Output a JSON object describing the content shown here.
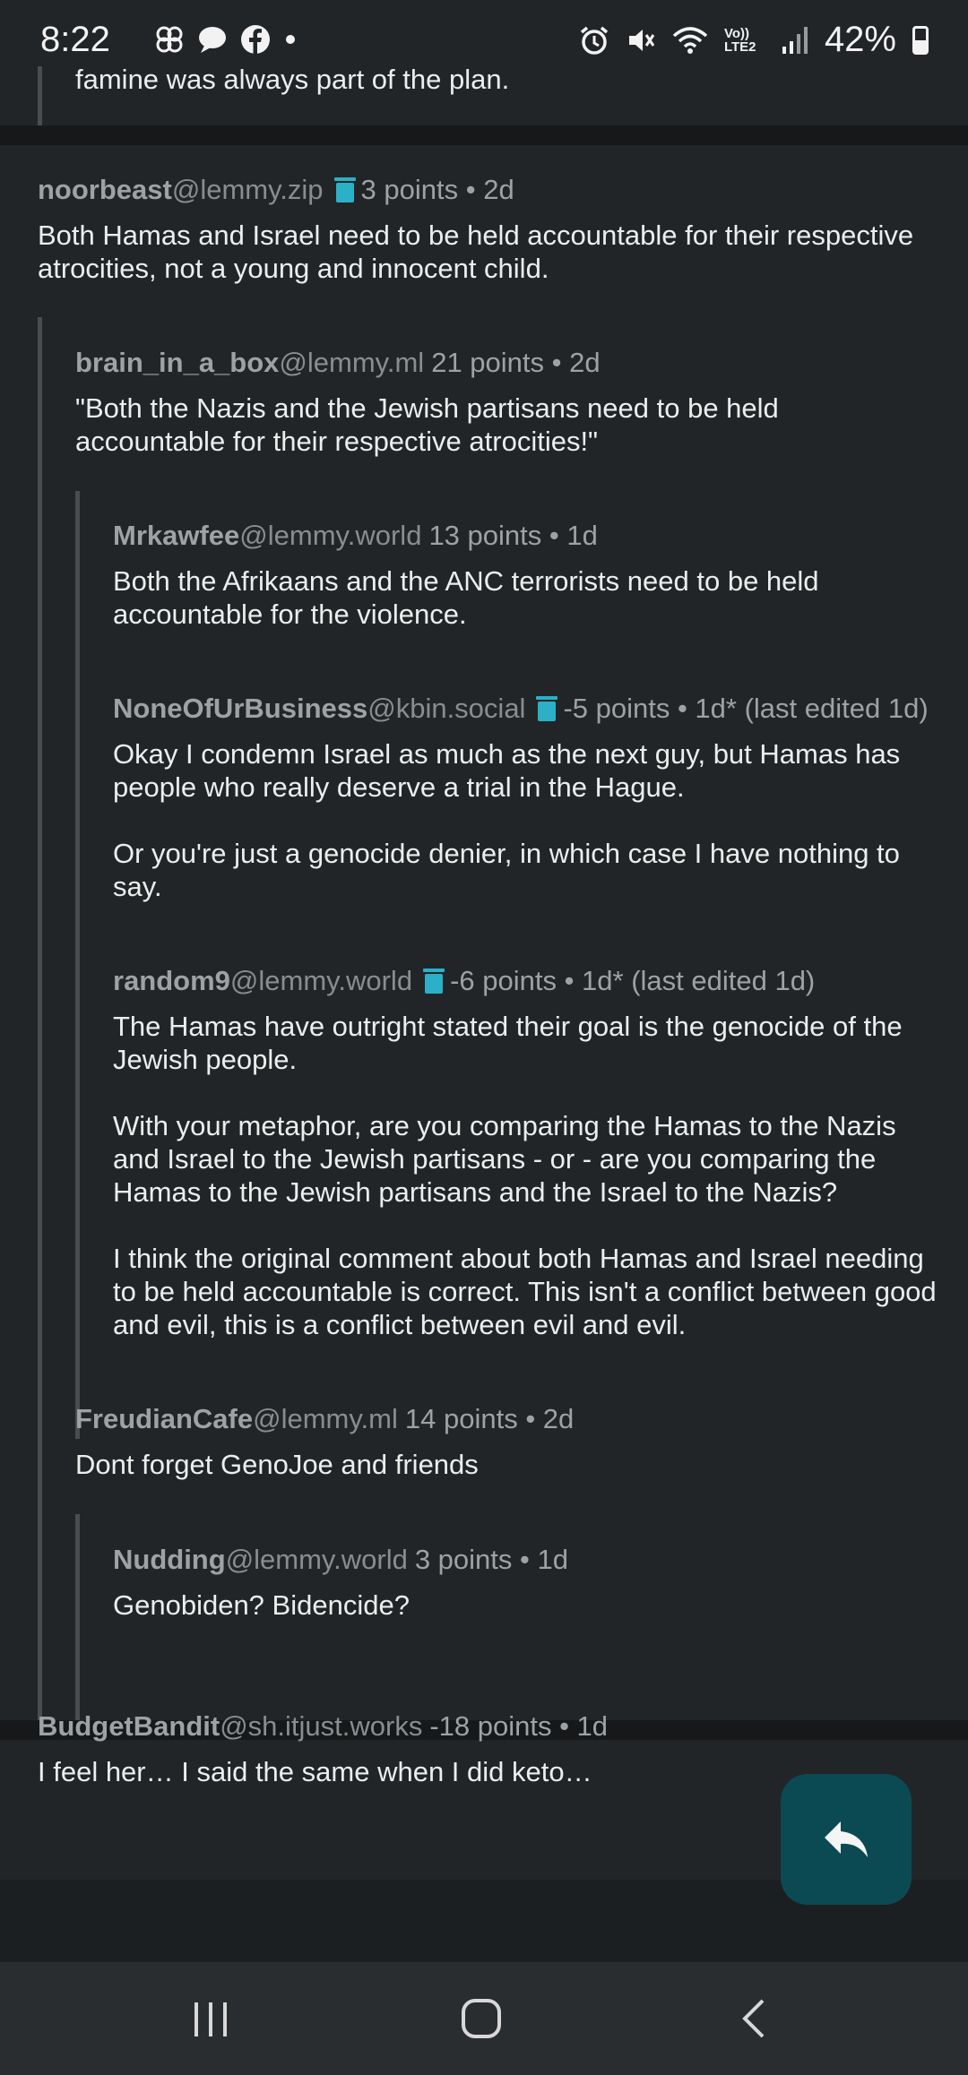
{
  "status_bar": {
    "time": "8:22",
    "left_icons": [
      "pinwheel-icon",
      "chat-bubble-icon",
      "facebook-icon",
      "dot-icon"
    ],
    "right_icons": [
      "alarm-icon",
      "mute-icon",
      "wifi-icon",
      "volte-icon",
      "signal-icon"
    ],
    "volte_label": "Vo)) LTE2",
    "battery_percent": "42%"
  },
  "colors": {
    "background": "#1c1f21",
    "card": "#222528",
    "accent_trash": "#2bb0c7",
    "fab": "#0b4a52"
  },
  "comments": {
    "partial": {
      "text": "famine was always part of the plan."
    },
    "c1": {
      "author": "noorbeast",
      "instance": "@lemmy.zip",
      "deleted_icon": true,
      "meta": "3 points • 2d",
      "body": [
        "Both Hamas and Israel need to be held accountable for their respective atrocities, not a young and innocent child."
      ]
    },
    "c2": {
      "author": "brain_in_a_box",
      "instance": "@lemmy.ml",
      "meta": "21 points • 2d",
      "body": [
        "\"Both the Nazis and the Jewish partisans need to be held accountable for their respective atrocities!\""
      ]
    },
    "c3": {
      "author": "Mrkawfee",
      "instance": "@lemmy.world",
      "meta": "13 points • 1d",
      "body": [
        "Both the Afrikaans and the ANC terrorists need to be held accountable for the violence."
      ]
    },
    "c4": {
      "author": "NoneOfUrBusiness",
      "instance": "@kbin.social",
      "deleted_icon": true,
      "meta": "-5 points • 1d* (last edited 1d)",
      "body": [
        "Okay I condemn Israel as much as the next guy, but Hamas has people who really deserve a trial in the Hague.",
        "Or you're just a genocide denier, in which case I have nothing to say."
      ]
    },
    "c5": {
      "author": "random9",
      "instance": "@lemmy.world",
      "deleted_icon": true,
      "meta": "-6 points • 1d* (last edited 1d)",
      "body": [
        "The Hamas have outright stated their goal is the genocide of the Jewish people.",
        "With your metaphor, are you comparing the Hamas to the Nazis and Israel to the Jewish partisans - or - are you comparing the Hamas to the Jewish partisans and the Israel to the Nazis?",
        "I think the original comment about both Hamas and Israel needing to be held accountable is correct. This isn't a conflict between good and evil, this is a conflict between evil and evil."
      ]
    },
    "c6": {
      "author": "FreudianCafe",
      "instance": "@lemmy.ml",
      "meta": "14 points • 2d",
      "body": [
        "Dont forget GenoJoe and friends"
      ]
    },
    "c7": {
      "author": "Nudding",
      "instance": "@lemmy.world",
      "meta": "3 points • 1d",
      "body": [
        "Genobiden? Bidencide?"
      ]
    },
    "c8": {
      "author": "BudgetBandit",
      "instance": "@sh.itjust.works",
      "meta": "-18 points • 1d",
      "body": [
        "I feel her… I said the same when I did keto…"
      ]
    }
  },
  "fab": {
    "icon": "reply-icon"
  },
  "nav_bar": {
    "icons": [
      "recent-apps-icon",
      "home-icon",
      "back-icon"
    ]
  }
}
